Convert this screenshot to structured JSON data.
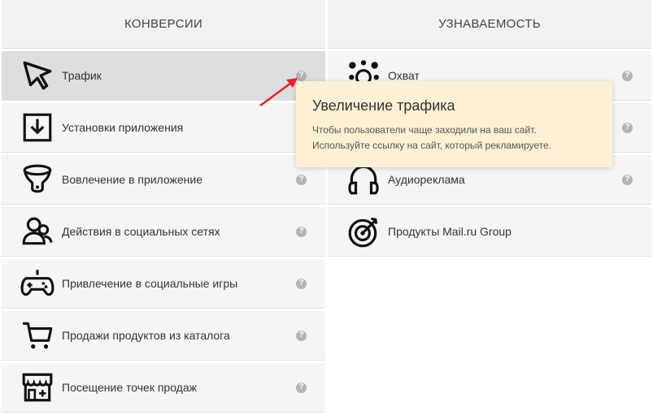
{
  "left": {
    "title": "КОНВЕРСИИ",
    "items": [
      {
        "label": "Трафик",
        "icon": "cursor-icon"
      },
      {
        "label": "Установки приложения",
        "icon": "download-box-icon"
      },
      {
        "label": "Вовлечение в приложение",
        "icon": "funnel-icon"
      },
      {
        "label": "Действия в социальных сетях",
        "icon": "users-icon"
      },
      {
        "label": "Привлечение в социальные игры",
        "icon": "gamepad-icon"
      },
      {
        "label": "Продажи продуктов из каталога",
        "icon": "cart-icon"
      },
      {
        "label": "Посещение точек продаж",
        "icon": "store-icon"
      }
    ]
  },
  "right": {
    "title": "УЗНАВАЕМОСТЬ",
    "items": [
      {
        "label": "Охват",
        "icon": "reach-icon"
      },
      {
        "label": "",
        "icon": "video-icon"
      },
      {
        "label": "Аудиореклама",
        "icon": "headphones-icon"
      },
      {
        "label": "Продукты Mail.ru Group",
        "icon": "target-icon"
      }
    ]
  },
  "help_glyph": "?",
  "tooltip": {
    "title": "Увеличение трафика",
    "line1": "Чтобы пользователи чаще заходили на ваш сайт.",
    "line2": "Используйте ссылку на сайт, который рекламируете."
  },
  "colors": {
    "arrow": "#e8202a",
    "tooltip_bg": "#fdf0d5",
    "active_bg": "#dedede"
  }
}
